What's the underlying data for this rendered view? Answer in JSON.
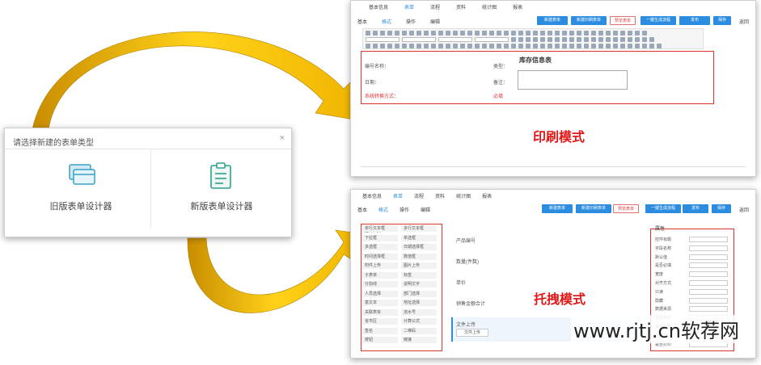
{
  "chooser": {
    "title": "请选择新建的表单类型",
    "close_symbol": "×",
    "old_designer": "旧版表单设计器",
    "new_designer": "新版表单设计器",
    "icon_color": "#3aa0c8"
  },
  "print_window": {
    "main_tabs": [
      "基本信息",
      "表单",
      "流程",
      "资料",
      "统计图",
      "报表"
    ],
    "active_main_tab": 1,
    "sub_tabs": [
      "基本",
      "格式",
      "操作",
      "编辑"
    ],
    "active_sub_tab": 1,
    "buttons": [
      "新建表单",
      "新建印刷表单",
      "预览表单",
      "一键生成流程",
      "发布",
      "保存"
    ],
    "extra_link": "返回",
    "form_title": "库存信息表",
    "fields": {
      "left_1": "编号名称：",
      "left_2": "日期：",
      "left_3": "系统转换方式：",
      "right_1": "类型：",
      "right_2": "备注：",
      "right_3": "必填"
    },
    "mode_label": "印刷模式"
  },
  "drag_window": {
    "main_tabs": [
      "基本信息",
      "表单",
      "流程",
      "资料",
      "统计图",
      "报表"
    ],
    "active_main_tab": 1,
    "sub_tabs": [
      "基本",
      "格式",
      "操作",
      "编辑"
    ],
    "active_sub_tab": 1,
    "buttons": [
      "新建表单",
      "新建印刷表单",
      "预览表单",
      "一键生成流程",
      "发布",
      "保存"
    ],
    "extra_link": "返回",
    "palette_title": "控件列表",
    "palette": [
      [
        "单行文本框",
        "多行文本框"
      ],
      [
        "下拉框",
        "单选框"
      ],
      [
        "多选框",
        "日期选择框"
      ],
      [
        "时间选择框",
        "数值框"
      ],
      [
        "附件上传",
        "图片上传"
      ],
      [
        "子表单",
        "标签"
      ],
      [
        "分割线",
        "说明文字"
      ],
      [
        "人员选择",
        "部门选择"
      ],
      [
        "富文本",
        "地址选择"
      ],
      [
        "关联表单",
        "流水号"
      ],
      [
        "省市区",
        "计算公式"
      ],
      [
        "签名",
        "二维码"
      ],
      [
        "按钮",
        "链接"
      ]
    ],
    "canvas_items": [
      "产品编号",
      "数量(件数)",
      "单价",
      "销售金额合计",
      "文件上传"
    ],
    "canvas_button": "文件上传",
    "props_title": "属性",
    "props": [
      "控件标题",
      "字段名称",
      "默认值",
      "是否必填",
      "宽度",
      "对齐方式",
      "只读",
      "隐藏",
      "数据来源",
      "验证规则",
      "提示信息",
      "关联字段",
      "是否打印"
    ],
    "mode_label": "托拽模式"
  },
  "watermark": "www.rjtj.cn软荐网",
  "colors": {
    "accent": "#2b8ce0",
    "highlight_red": "#e01818",
    "arrow_gold": "#e5b20a"
  }
}
